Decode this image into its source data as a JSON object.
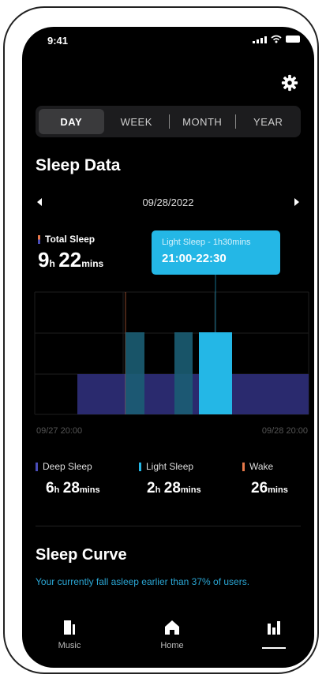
{
  "status": {
    "time": "9:41"
  },
  "tabs": [
    {
      "label": "DAY",
      "active": true
    },
    {
      "label": "WEEK",
      "active": false
    },
    {
      "label": "MONTH",
      "active": false
    },
    {
      "label": "YEAR",
      "active": false
    }
  ],
  "page_title": "Sleep Data",
  "date": "09/28/2022",
  "total": {
    "label": "Total Sleep",
    "hours": "9",
    "h_unit": "h",
    "mins": "22",
    "mins_unit": "mins"
  },
  "tooltip": {
    "line1": "Light Sleep - 1h30mins",
    "line2": "21:00-22:30"
  },
  "chart_axis": {
    "start": "09/27 20:00",
    "end": "09/28 20:00"
  },
  "legend": [
    {
      "label": "Deep Sleep",
      "hours": "6",
      "mins": "28",
      "color": "#4a4db8"
    },
    {
      "label": "Light Sleep",
      "hours": "2",
      "mins": "28",
      "color": "#24b7e6"
    },
    {
      "label": "Wake",
      "mins": "26",
      "color": "#e8794a"
    }
  ],
  "units": {
    "h": "h",
    "mins": "mins"
  },
  "curve": {
    "title": "Sleep Curve",
    "subtitle": "Your currently fall asleep earlier than 37% of users."
  },
  "nav": [
    {
      "label": "Music",
      "icon": "music-icon"
    },
    {
      "label": "Home",
      "icon": "home-icon"
    },
    {
      "label": "",
      "icon": "bar-chart-icon",
      "active": true
    }
  ],
  "colors": {
    "accent": "#24b7e6",
    "deep": "#2a2a6e",
    "wake": "#e8794a"
  }
}
